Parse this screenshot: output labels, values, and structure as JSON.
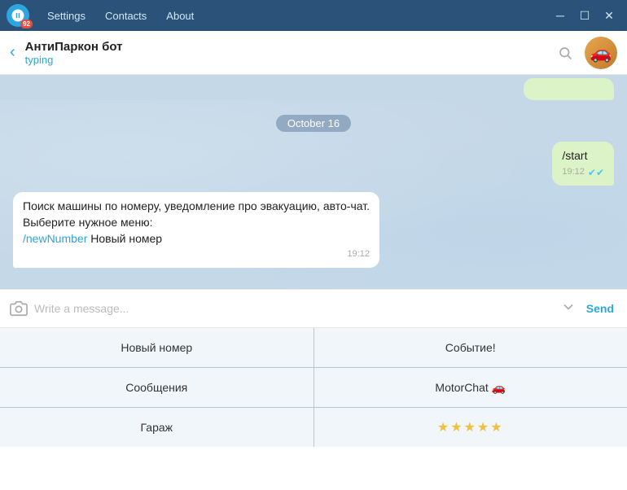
{
  "titlebar": {
    "badge": "92",
    "menu": [
      "Settings",
      "Contacts",
      "About"
    ],
    "controls": [
      "minimize",
      "maximize",
      "close"
    ]
  },
  "header": {
    "name": "АнтиПаркон бот",
    "status": "typing",
    "back_icon": "‹",
    "search_icon": "🔍",
    "avatar_emoji": "🚗"
  },
  "chat": {
    "date_label": "October 16",
    "messages": [
      {
        "id": "msg-start",
        "type": "outgoing",
        "text": "/start",
        "time": "19:12",
        "check": "✔✔"
      },
      {
        "id": "msg-reply",
        "type": "incoming",
        "text": "Поиск машины по номеру, уведомление про эвакуацию, авто-чат.\nВыберите нужное меню:\n/newNumber Новый номер",
        "link_text": "/newNumber",
        "time": "19:12"
      }
    ]
  },
  "input": {
    "placeholder": "Write a message...",
    "send_label": "Send",
    "camera_icon": "📷",
    "emoji_icon": "⌄"
  },
  "keyboard": {
    "buttons": [
      {
        "id": "btn-new-number",
        "label": "Новый номер",
        "col": 1
      },
      {
        "id": "btn-event",
        "label": "Событие!",
        "col": 2
      },
      {
        "id": "btn-messages",
        "label": "Сообщения",
        "col": 1
      },
      {
        "id": "btn-motorchat",
        "label": "MotorChat 🚗",
        "col": 2
      },
      {
        "id": "btn-garage",
        "label": "Гараж",
        "col": 1
      },
      {
        "id": "btn-stars",
        "label": "⭐⭐⭐⭐⭐",
        "col": 2
      }
    ]
  }
}
